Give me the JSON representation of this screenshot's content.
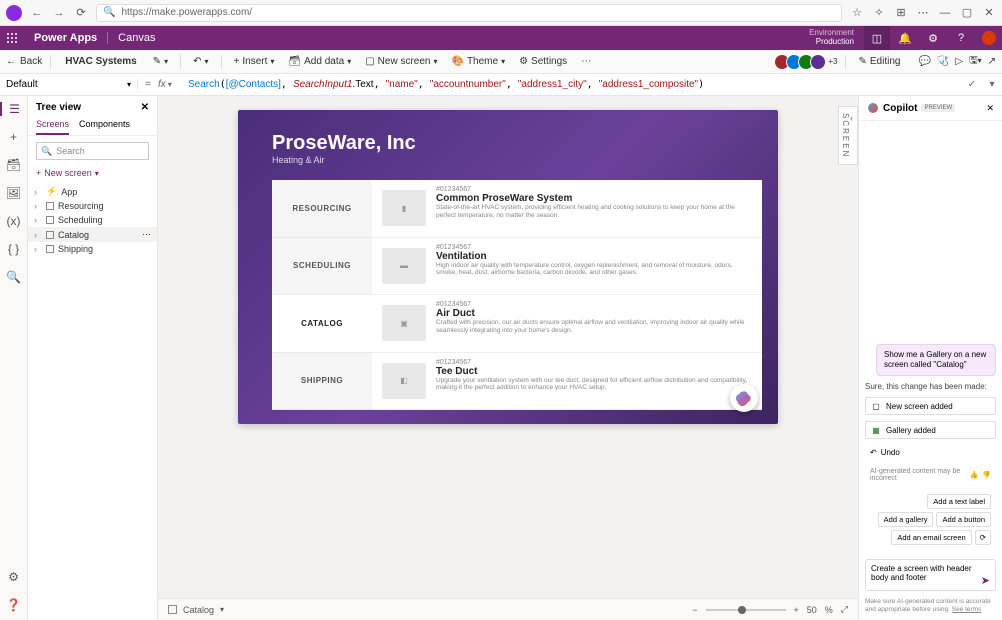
{
  "browser": {
    "url": "https://make.powerapps.com/"
  },
  "suite": {
    "brand": "Power Apps",
    "subbrand": "Canvas",
    "env_label": "Environment",
    "env_name": "Production"
  },
  "cmd": {
    "back": "Back",
    "app_title": "HVAC Systems",
    "insert": "Insert",
    "add_data": "Add data",
    "new_screen": "New screen",
    "theme": "Theme",
    "settings": "Settings",
    "editing": "Editing",
    "extra_avatars": "+3"
  },
  "formula": {
    "property": "Default",
    "fx": "fx",
    "fn": "Search",
    "arg_table": "[@Contacts]",
    "arg_input": "SearchInput1",
    "arg_input_prop": ".Text",
    "s1": "\"name\"",
    "s2": "\"accountnumber\"",
    "s3": "\"address1_city\"",
    "s4": "\"address1_composite\""
  },
  "tree": {
    "title": "Tree view",
    "tab_screens": "Screens",
    "tab_components": "Components",
    "search_placeholder": "Search",
    "new_screen": "New screen",
    "items": [
      {
        "label": "App"
      },
      {
        "label": "Resourcing"
      },
      {
        "label": "Scheduling"
      },
      {
        "label": "Catalog"
      },
      {
        "label": "Shipping"
      }
    ]
  },
  "preview": {
    "company": "ProseWare, Inc",
    "tagline": "Heating & Air",
    "nav": [
      "RESOURCING",
      "SCHEDULING",
      "CATALOG",
      "SHIPPING"
    ],
    "cards": [
      {
        "code": "#01234567",
        "name": "Common ProseWare System",
        "desc": "State-of-the-art HVAC system, providing efficient heating and cooling solutions to keep your home at the perfect temperature, no matter the season."
      },
      {
        "code": "#01234567",
        "name": "Ventilation",
        "desc": "High indoor air quality with temperature control, oxygen replenishment, and removal of moisture, odors, smoke, heat, dust, airborne bacteria, carbon dioxide, and other gases."
      },
      {
        "code": "#01234567",
        "name": "Air Duct",
        "desc": "Crafted with precision, our air ducts ensure optimal airflow and ventilation, improving indoor air quality while seamlessly integrating into your home's design."
      },
      {
        "code": "#01234567",
        "name": "Tee Duct",
        "desc": "Upgrade your ventilation system with our tee duct, designed for efficient airflow distribution and compatibility, making it the perfect addition to enhance your HVAC setup."
      }
    ]
  },
  "status": {
    "element": "Catalog",
    "zoom": "50",
    "zoom_unit": "%"
  },
  "copilot": {
    "title": "Copilot",
    "badge": "PREVIEW",
    "user_message": "Show me a Gallery on a new screen called \"Catalog\"",
    "sys_message": "Sure, this change has been made:",
    "actions": [
      {
        "icon": "screen",
        "label": "New screen added"
      },
      {
        "icon": "gallery",
        "label": "Gallery added"
      }
    ],
    "undo": "Undo",
    "disclaimer": "AI-generated content may be incorrect",
    "suggestions": [
      "Add a text label",
      "Add a gallery",
      "Add a button",
      "Add an email screen"
    ],
    "input_value": "Create a screen with header body and footer",
    "footer": "Make sure AI-generated content is accurate and appropriate before using.",
    "footer_link": "See terms"
  },
  "screen_tab": "SCREEN"
}
